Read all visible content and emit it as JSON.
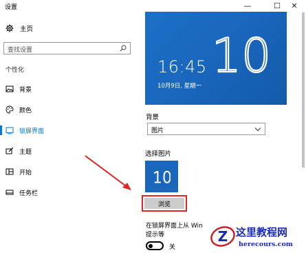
{
  "window": {
    "title": "设置",
    "controls": {
      "minimize": "—",
      "maximize": "☐",
      "close": "✕"
    }
  },
  "sidebar": {
    "home_label": "主页",
    "search_placeholder": "查找设置",
    "section_label": "个性化",
    "items": [
      {
        "label": "背景",
        "icon": "picture-icon",
        "selected": false
      },
      {
        "label": "颜色",
        "icon": "palette-icon",
        "selected": false
      },
      {
        "label": "锁屏界面",
        "icon": "lock-screen-icon",
        "selected": true
      },
      {
        "label": "主题",
        "icon": "theme-brush-icon",
        "selected": false
      },
      {
        "label": "开始",
        "icon": "start-menu-icon",
        "selected": false
      },
      {
        "label": "任务栏",
        "icon": "taskbar-icon",
        "selected": false
      }
    ]
  },
  "preview": {
    "logo_text": "10",
    "time": "16:45",
    "date": "10月9日, 星期一"
  },
  "background": {
    "label": "背景",
    "selected_value": "图片"
  },
  "choose_picture": {
    "label": "选择图片",
    "thumbnail_text": "10",
    "browse_label": "浏览"
  },
  "lock_screen_setting": {
    "description_line1": "在锁屏界面上从 Win",
    "description_line2": "提示等",
    "toggle_state_label": "关",
    "toggle_on": false
  },
  "watermark": {
    "title": "这里教程网",
    "url": "herecours.com"
  },
  "colors": {
    "accent": "#0078d7",
    "preview_bg": "#1a66bd",
    "highlight": "#e02525",
    "watermark": "#1a2bb5"
  }
}
